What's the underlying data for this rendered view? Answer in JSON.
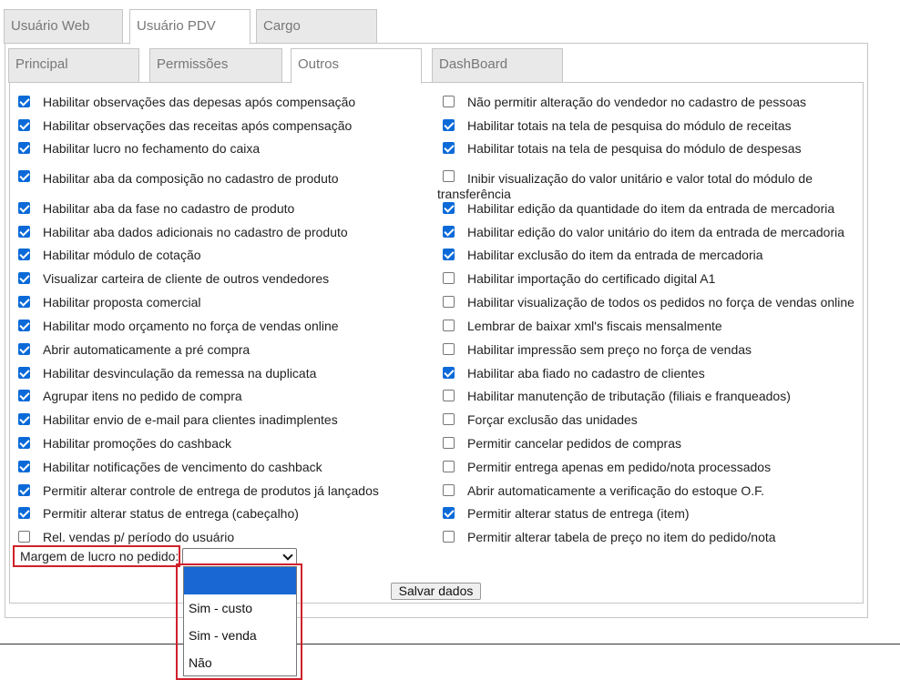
{
  "top_tabs": [
    "Usuário Web",
    "Usuário PDV",
    "Cargo"
  ],
  "sub_tabs": [
    "Principal",
    "Permissões",
    "Outros",
    "DashBoard"
  ],
  "left_options": [
    {
      "label": "Habilitar observações das depesas após compensação",
      "checked": true
    },
    {
      "label": "Habilitar observações das receitas após compensação",
      "checked": true
    },
    {
      "label": "Habilitar lucro no fechamento do caixa",
      "checked": true
    },
    {
      "label": "Habilitar aba da composição no cadastro de produto",
      "checked": true
    },
    {
      "label": "Habilitar aba da fase no cadastro de produto",
      "checked": true
    },
    {
      "label": "Habilitar aba dados adicionais no cadastro de produto",
      "checked": true
    },
    {
      "label": "Habilitar módulo de cotação",
      "checked": true
    },
    {
      "label": "Visualizar carteira de cliente de outros vendedores",
      "checked": true
    },
    {
      "label": "Habilitar proposta comercial",
      "checked": true
    },
    {
      "label": "Habilitar modo orçamento no força de vendas online",
      "checked": true
    },
    {
      "label": "Abrir automaticamente a pré compra",
      "checked": true
    },
    {
      "label": "Habilitar desvinculação da remessa na duplicata",
      "checked": true
    },
    {
      "label": "Agrupar itens no pedido de compra",
      "checked": true
    },
    {
      "label": "Habilitar envio de e-mail para clientes inadimplentes",
      "checked": true
    },
    {
      "label": "Habilitar promoções do cashback",
      "checked": true
    },
    {
      "label": "Habilitar notificações de vencimento do cashback",
      "checked": true
    },
    {
      "label": "Permitir alterar controle de entrega de produtos já lançados",
      "checked": true
    },
    {
      "label": "Permitir alterar status de entrega (cabeçalho)",
      "checked": true
    },
    {
      "label": "Rel. vendas p/ período do usuário",
      "checked": false
    }
  ],
  "right_options": [
    {
      "label": "Não permitir alteração do vendedor no cadastro de pessoas",
      "checked": false
    },
    {
      "label": "Habilitar totais na tela de pesquisa do módulo de receitas",
      "checked": true
    },
    {
      "label": "Habilitar totais na tela de pesquisa do módulo de despesas",
      "checked": true
    },
    {
      "label": "Inibir visualização do valor unitário e valor total do módulo de transferência",
      "checked": false
    },
    {
      "label": "Habilitar edição da quantidade do item da entrada de mercadoria",
      "checked": true
    },
    {
      "label": "Habilitar edição do valor unitário do item da entrada de mercadoria",
      "checked": true
    },
    {
      "label": "Habilitar exclusão do item da entrada de mercadoria",
      "checked": true
    },
    {
      "label": "Habilitar importação do certificado digital A1",
      "checked": false
    },
    {
      "label": "Habilitar visualização de todos os pedidos no força de vendas online",
      "checked": false
    },
    {
      "label": "Lembrar de baixar xml's fiscais mensalmente",
      "checked": false
    },
    {
      "label": "Habilitar impressão sem preço no força de vendas",
      "checked": false
    },
    {
      "label": "Habilitar aba fiado no cadastro de clientes",
      "checked": true
    },
    {
      "label": "Habilitar manutenção de tributação (filiais e franqueados)",
      "checked": false
    },
    {
      "label": "Forçar exclusão das unidades",
      "checked": false
    },
    {
      "label": "Permitir cancelar pedidos de compras",
      "checked": false
    },
    {
      "label": "Permitir entrega apenas em pedido/nota processados",
      "checked": false
    },
    {
      "label": "Abrir automaticamente a verificação do estoque O.F.",
      "checked": false
    },
    {
      "label": "Permitir alterar status de entrega (item)",
      "checked": true
    },
    {
      "label": "Permitir alterar tabela de preço no item do pedido/nota",
      "checked": false
    }
  ],
  "margin_field": {
    "label": "Margem de lucro no pedido:",
    "selected": "",
    "options": [
      "",
      "Sim - custo",
      "Sim - venda",
      "Não"
    ]
  },
  "save_button": "Salvar dados",
  "colors": {
    "checkbox": "#0b6ad8",
    "highlight": "#d0202a",
    "dropdown_selected": "#1967d2"
  }
}
